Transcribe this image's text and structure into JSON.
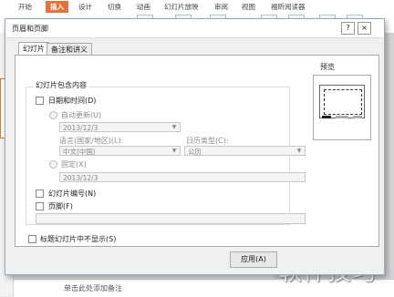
{
  "ribbon": {
    "tabs": [
      "开始",
      "插入",
      "设计",
      "切换",
      "动画",
      "幻灯片放映",
      "审阅",
      "视图",
      "福昕阅读器"
    ],
    "active_tab": "插入"
  },
  "notes_placeholder": "单击此处添加备注",
  "watermark": "软件技巧",
  "dialog": {
    "title": "页眉和页脚",
    "help_button": "?",
    "close_button": "×",
    "tabs": [
      "幻灯片",
      "备注和讲义"
    ],
    "group_title": "幻灯片包含内容",
    "date_time_label": "日期和时间(D)",
    "auto_update_label": "自动更新(U)",
    "auto_update_value": "2013/12/3",
    "language_label": "语言(国家/地区)(L):",
    "language_value": "中文(中国)",
    "calendar_label": "日历类型(C):",
    "calendar_value": "公历",
    "fixed_label": "固定(X)",
    "fixed_value": "2013/12/3",
    "slide_number_label": "幻灯片编号(N)",
    "footer_label": "页脚(F)",
    "footer_value": "",
    "hide_on_title_label": "标题幻灯片中不显示(S)",
    "preview_label": "预览",
    "apply_button": "应用(A)"
  }
}
